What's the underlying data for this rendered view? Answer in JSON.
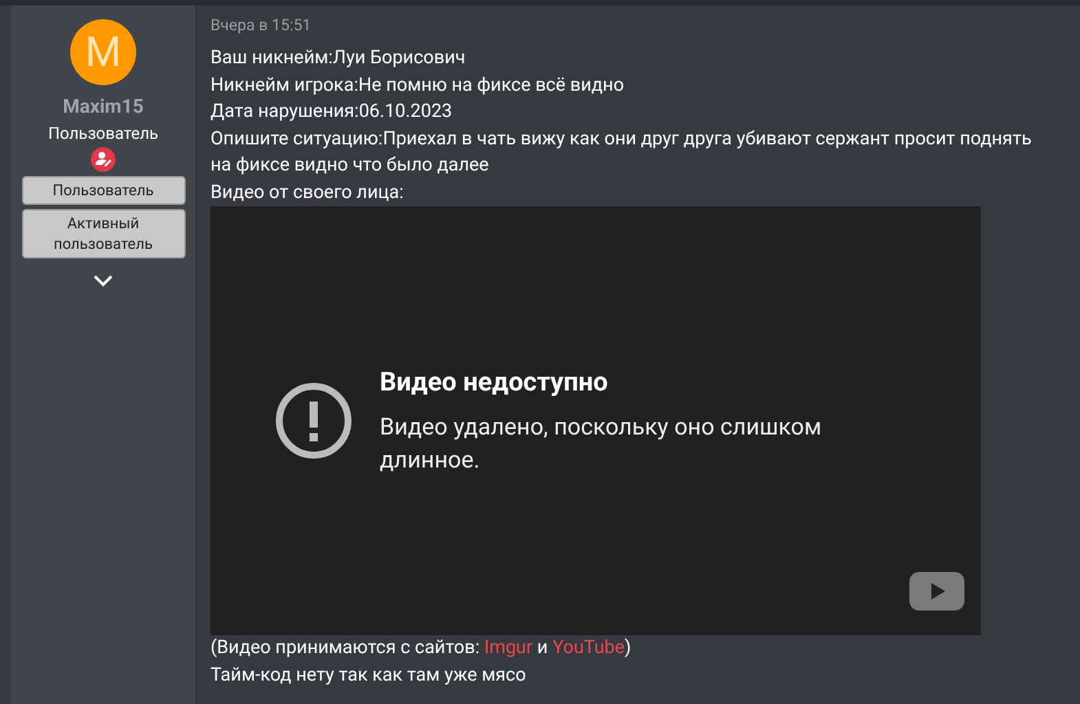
{
  "author": {
    "avatar_letter": "M",
    "name": "Maxim15",
    "title": "Пользователь",
    "banners": [
      "Пользователь",
      "Активный пользователь"
    ]
  },
  "post": {
    "time": "Вчера в 15:51",
    "lines": [
      "Ваш никнейм:Луи Борисович",
      "Никнейм игрока:Не помню на фиксе всё видно",
      "Дата нарушения:06.10.2023",
      "Опишите ситуацию:Приехал в чать вижу как они друг друга убивают сержант просит поднять",
      "на фиксе видно что было далее",
      "Видео от своего лица:"
    ],
    "video": {
      "title": "Видео недоступно",
      "message": "Видео удалено, поскольку оно слишком длинное."
    },
    "note": {
      "prefix": "(Видео принимаются с сайтов: ",
      "links": [
        "Imgur",
        "YouTube"
      ],
      "middle": " и ",
      "suffix": ")"
    },
    "after": [
      "Тайм-код нету так как там уже мясо"
    ]
  }
}
